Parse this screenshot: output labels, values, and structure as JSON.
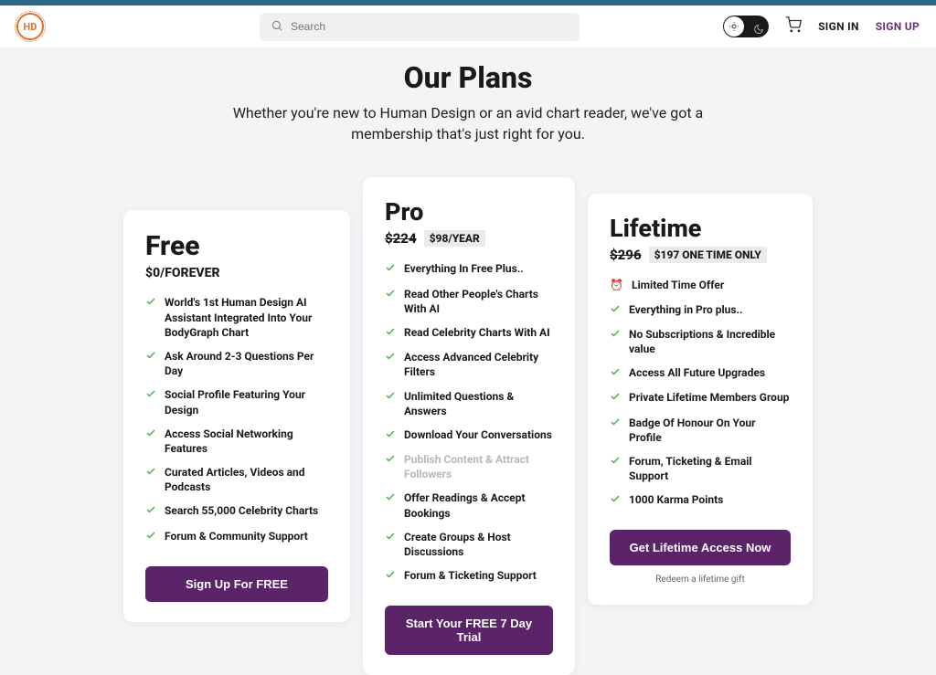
{
  "header": {
    "search_placeholder": "Search",
    "signin": "SIGN IN",
    "signup": "SIGN UP"
  },
  "hero": {
    "title": "Our Plans",
    "subtitle": "Whether you're new to Human Design or an avid chart reader, we've got a membership that's just right for you."
  },
  "plans": {
    "free": {
      "name": "Free",
      "price": "$0/FOREVER",
      "features": [
        "World's 1st Human Design AI Assistant Integrated Into Your BodyGraph Chart",
        "Ask Around 2-3 Questions Per Day",
        "Social Profile Featuring Your Design",
        "Access Social Networking Features",
        "Curated Articles, Videos and Podcasts",
        "Search 55,000 Celebrity Charts",
        "Forum & Community Support"
      ],
      "cta": "Sign Up For FREE"
    },
    "pro": {
      "name": "Pro",
      "old_price": "$224",
      "new_price": "$98/YEAR",
      "features": [
        "Everything In Free Plus..",
        "Read Other People's Charts With AI",
        "Read Celebrity Charts With AI",
        "Access Advanced Celebrity Filters",
        "Unlimited Questions & Answers",
        "Download Your Conversations",
        "Publish Content & Attract Followers",
        "Offer Readings & Accept Bookings",
        "Create Groups & Host Discussions",
        "Forum & Ticketing Support"
      ],
      "muted_index": 6,
      "cta": "Start Your FREE 7 Day Trial"
    },
    "lifetime": {
      "name": "Lifetime",
      "old_price": "$296",
      "new_price": "$197 ONE TIME ONLY",
      "limited_label": "Limited Time Offer",
      "features": [
        "Everything in Pro plus..",
        "No Subscriptions & Incredible value",
        "Access All Future Upgrades",
        "Private Lifetime Members Group",
        "Badge Of Honour On Your Profile",
        "Forum, Ticketing & Email Support",
        "1000 Karma Points"
      ],
      "cta": "Get Lifetime Access Now",
      "redeem": "Redeem a lifetime gift"
    }
  }
}
